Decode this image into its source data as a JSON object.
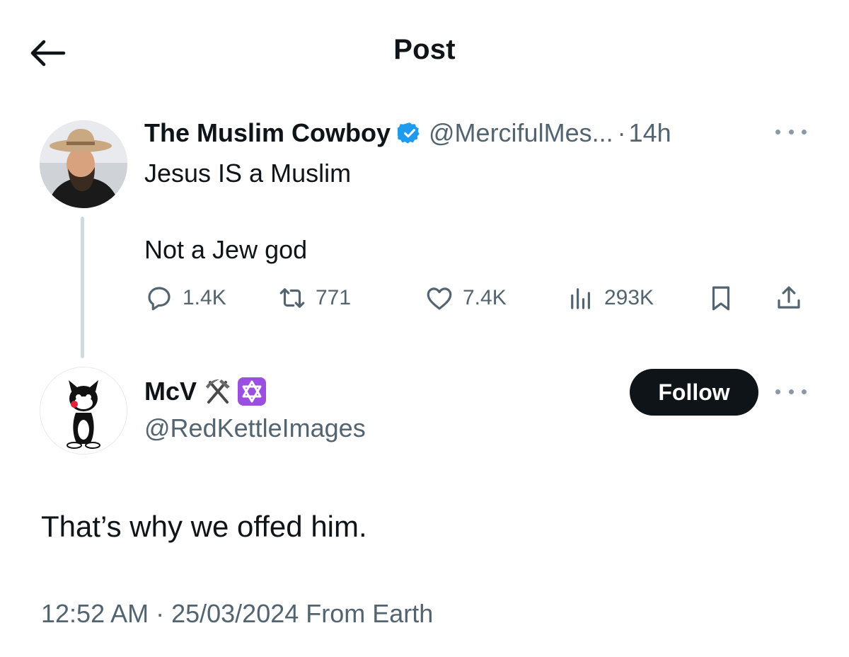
{
  "header": {
    "title": "Post",
    "back_icon": "arrow-left-icon"
  },
  "parent_post": {
    "author_name": "The Muslim Cowboy",
    "verified": true,
    "handle": "@MercifulMes...",
    "separator": "·",
    "time": "14h",
    "text_line1": "Jesus IS a Muslim",
    "text_line2": "Not a Jew god",
    "stats": {
      "replies": "1.4K",
      "reposts": "771",
      "likes": "7.4K",
      "views": "293K"
    }
  },
  "reply_post": {
    "author_name": "McV",
    "emojis": [
      "hammer-and-pick-icon",
      "star-of-david-icon"
    ],
    "handle": "@RedKettleImages",
    "follow_label": "Follow",
    "text": "That’s why we offed him.",
    "timestamp": "12:52 AM · 25/03/2024 From Earth"
  },
  "colors": {
    "text": "#0f1419",
    "secondary": "#536471",
    "verified_blue": "#1d9bf0",
    "follow_bg": "#0f1419",
    "emoji_purple": "#9a4fe0"
  }
}
